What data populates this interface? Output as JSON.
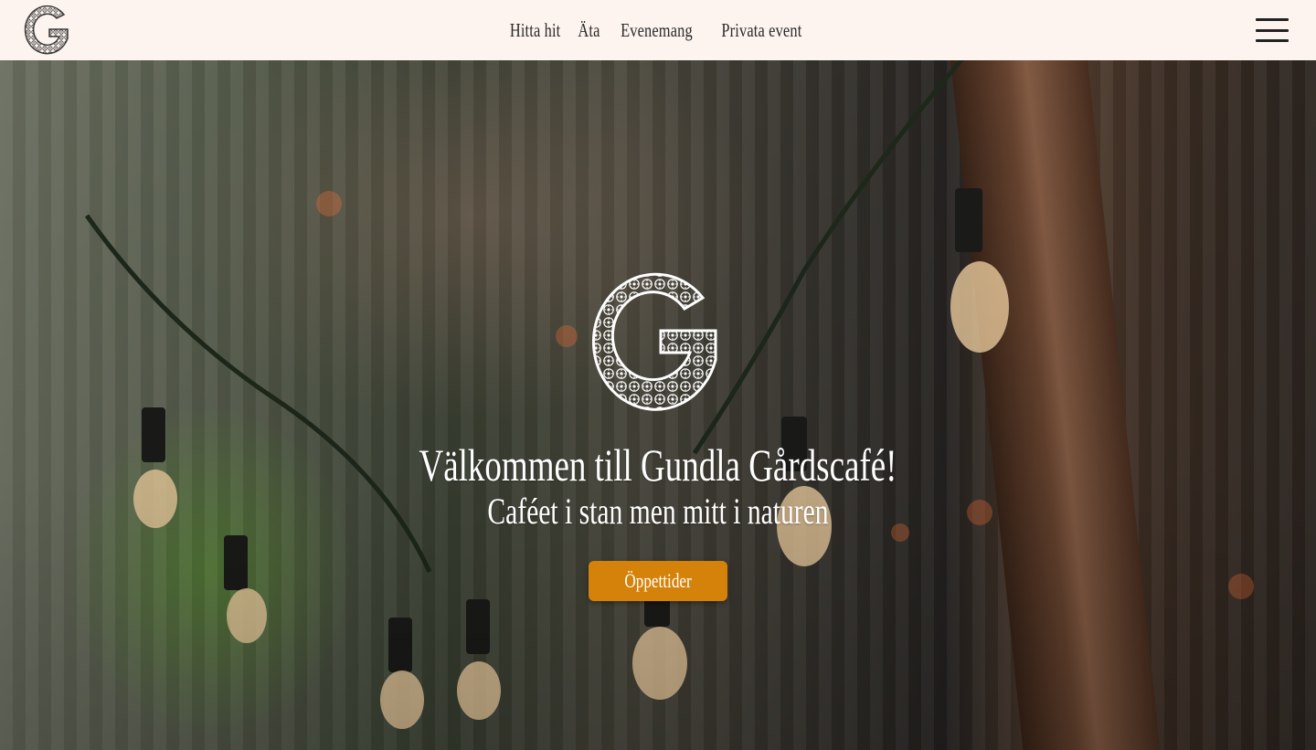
{
  "header": {
    "logo_icon": "flower-g-logo-icon",
    "nav": [
      {
        "label": "Hitta hit"
      },
      {
        "label": "Äta"
      },
      {
        "label": "Evenemang"
      },
      {
        "label": "Privata event"
      }
    ],
    "menu_icon": "hamburger-menu-icon"
  },
  "hero": {
    "logo_icon": "flower-g-logo-icon",
    "title": "Välkommen till Gundla Gårdscafé!",
    "subtitle": "Caféet i stan men mitt i naturen",
    "cta_label": "Öppettider",
    "background": "string-lights-photo"
  },
  "colors": {
    "topbar_bg": "#fdf4f0",
    "cta_bg": "#d4820a",
    "nav_text": "#2a2a2a"
  }
}
